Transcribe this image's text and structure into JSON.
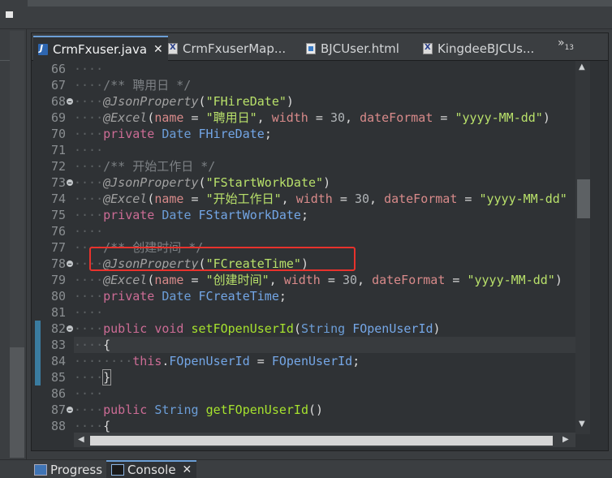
{
  "editor": {
    "tabs": [
      {
        "label": "CrmFxuser.java",
        "icon": "java-file-icon",
        "active": true,
        "close": "✕"
      },
      {
        "label": "CrmFxuserMap...",
        "icon": "xml-file-icon",
        "active": false
      },
      {
        "label": "BJCUser.html",
        "icon": "html-file-icon",
        "active": false
      },
      {
        "label": "KingdeeBJCUs...",
        "icon": "xml-file-icon",
        "active": false
      }
    ],
    "overflow": "»",
    "overflow_count": "13",
    "lines": [
      {
        "n": "66"
      },
      {
        "n": "67",
        "comment": "/** 聘用日 */"
      },
      {
        "n": "68",
        "ann": "@JsonProperty",
        "str": "\"FHireDate\""
      },
      {
        "n": "69",
        "ann": "@Excel",
        "a1": "name",
        "s1": "\"聘用日\"",
        "a2": "width",
        "v2": "30",
        "a3": "dateFormat",
        "s3": "\"yyyy-MM-dd\""
      },
      {
        "n": "70",
        "kw": "private",
        "type": "Date",
        "field": "FHireDate"
      },
      {
        "n": "71"
      },
      {
        "n": "72",
        "comment": "/** 开始工作日 */"
      },
      {
        "n": "73",
        "ann": "@JsonProperty",
        "str": "\"FStartWorkDate\""
      },
      {
        "n": "74",
        "ann": "@Excel",
        "a1": "name",
        "s1": "\"开始工作日\"",
        "a2": "width",
        "v2": "30",
        "a3": "dateFormat",
        "s3": "\"yyyy-MM-dd\""
      },
      {
        "n": "75",
        "kw": "private",
        "type": "Date",
        "field": "FStartWorkDate"
      },
      {
        "n": "76"
      },
      {
        "n": "77",
        "comment": "/** 创建时间 */"
      },
      {
        "n": "78",
        "ann": "@JsonProperty",
        "str": "\"FCreateTime\""
      },
      {
        "n": "79",
        "ann": "@Excel",
        "a1": "name",
        "s1": "\"创建时间\"",
        "a2": "width",
        "v2": "30",
        "a3": "dateFormat",
        "s3": "\"yyyy-MM-dd\""
      },
      {
        "n": "80",
        "kw": "private",
        "type": "Date",
        "field": "FCreateTime"
      },
      {
        "n": "81"
      },
      {
        "n": "82",
        "kw": "public",
        "kw2": "void",
        "method": "setFOpenUserId",
        "ptype": "String",
        "param": "FOpenUserId"
      },
      {
        "n": "83",
        "brace": "{"
      },
      {
        "n": "84",
        "this": "this",
        "field": "FOpenUserId",
        "rhs": "FOpenUserId"
      },
      {
        "n": "85",
        "brace": "}"
      },
      {
        "n": "86"
      },
      {
        "n": "87",
        "kw": "public",
        "type": "String",
        "method": "getFOpenUserId"
      },
      {
        "n": "88",
        "brace": "{"
      }
    ]
  },
  "bottom": {
    "tabs": [
      {
        "label": "Progress",
        "icon": "progress-icon"
      },
      {
        "label": "Console",
        "icon": "console-icon",
        "active": true,
        "close": "✕"
      }
    ]
  },
  "colors": {
    "highlight_box": "#e8322c",
    "active_tab_accent": "#6c9fd6"
  }
}
